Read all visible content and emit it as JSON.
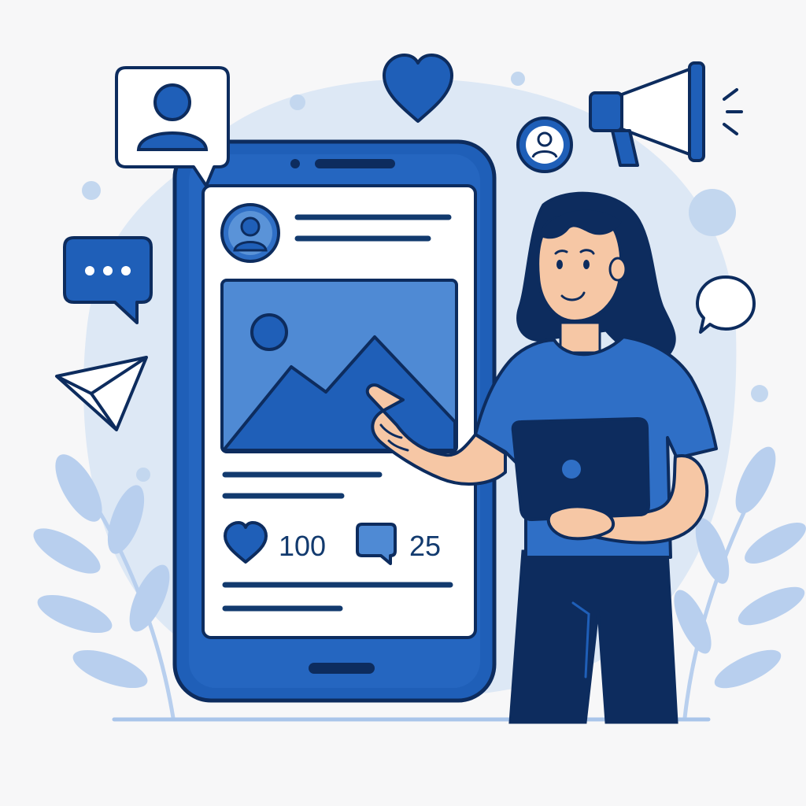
{
  "post": {
    "likes_count": "100",
    "comments_count": "25"
  },
  "icons": {
    "profile_bubble": "user-speech-bubble-icon",
    "heart": "heart-icon",
    "profile_circle": "user-circle-icon",
    "megaphone": "megaphone-icon",
    "chat": "chat-dots-icon",
    "send": "paper-plane-icon",
    "empty_chat": "speech-bubble-icon",
    "like": "heart-icon",
    "comment": "comment-icon"
  },
  "colors": {
    "primary": "#1f5fb8",
    "dark": "#0d2c5e",
    "light": "#c9dcf1",
    "skin": "#f6c7a5",
    "background": "#f7f7f8"
  }
}
